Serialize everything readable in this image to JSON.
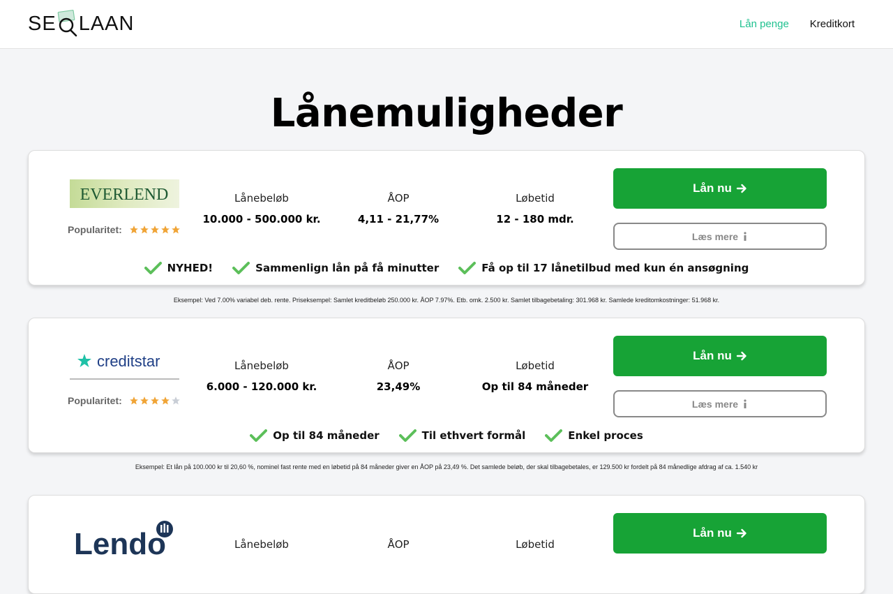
{
  "header": {
    "logo_text_1": "SE",
    "logo_text_2": "LAAN",
    "nav": [
      {
        "label": "Lån penge",
        "active": true
      },
      {
        "label": "Kreditkort",
        "active": false
      }
    ]
  },
  "page_title": "Lånemuligheder",
  "accent_color": "#17a336",
  "nav_active_color": "#1fc18f",
  "offers": [
    {
      "brand": "EVERLEND",
      "popularity_label": "Popularitet:",
      "stars": 5,
      "loan_amount_label": "Lånebeløb",
      "loan_amount": "10.000 - 500.000 kr.",
      "aop_label": "ÅOP",
      "aop": "4,11 - 21,77%",
      "term_label": "Løbetid",
      "term": "12 - 180 mdr.",
      "cta": "Lån nu",
      "more": "Læs mere",
      "features": [
        "NYHED!",
        "Sammenlign lån på få minutter",
        "Få op til 17 lånetilbud med kun én ansøgning"
      ],
      "example": "Eksempel: Ved 7.00% variabel deb. rente. Priseksempel: Samlet kreditbeløb 250.000 kr. ÅOP 7.97%. Etb. omk. 2.500 kr. Samlet tilbagebetaling: 301.968 kr. Samlede kreditomkostninger: 51.968 kr."
    },
    {
      "brand": "creditstar",
      "popularity_label": "Popularitet:",
      "stars": 4,
      "loan_amount_label": "Lånebeløb",
      "loan_amount": "6.000 - 120.000 kr.",
      "aop_label": "ÅOP",
      "aop": "23,49%",
      "term_label": "Løbetid",
      "term": "Op til 84 måneder",
      "cta": "Lån nu",
      "more": "Læs mere",
      "features": [
        "Op til 84 måneder",
        "Til ethvert formål",
        "Enkel proces"
      ],
      "example": "Eksempel: Et lån på 100.000 kr til 20,60 %, nominel fast rente med en løbetid på 84 måneder giver en ÅOP på 23,49 %. Det samlede beløb, der skal tilbagebetales, er 129.500 kr fordelt på 84 månedlige afdrag af ca. 1.540 kr"
    },
    {
      "brand": "Lendo",
      "loan_amount_label": "Lånebeløb",
      "aop_label": "ÅOP",
      "term_label": "Løbetid",
      "cta": "Lån nu"
    }
  ]
}
